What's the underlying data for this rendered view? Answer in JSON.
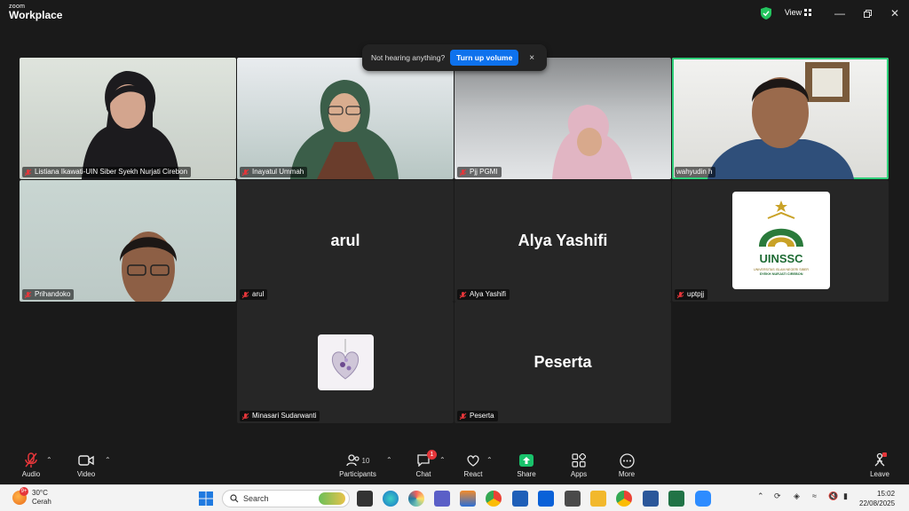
{
  "app": {
    "logo_small": "zoom",
    "logo_big": "Workplace",
    "view_label": "View"
  },
  "notification": {
    "text": "Not hearing anything?",
    "button": "Turn up volume",
    "close": "×"
  },
  "participants": [
    {
      "name": "Listiana Ikawati-UIN Siber Syekh Nurjati Cirebon",
      "video": true
    },
    {
      "name": "Inayatul Ummah",
      "video": true
    },
    {
      "name": "Pjj PGMI",
      "video": true
    },
    {
      "name": "wahyudin h",
      "video": true,
      "active_speaker": true
    },
    {
      "name": "Prihandoko",
      "video": true
    },
    {
      "name": "arul",
      "display": "arul",
      "video": false
    },
    {
      "name": "Alya Yashifi",
      "display": "Alya Yashifi",
      "video": false
    },
    {
      "name": "uptpjj",
      "video": false,
      "logo_text": "UINSSC",
      "logo_sub": "UNIVERSITAS ISLAM NEGERI SIBER\nSYEKH NURJATI CIREBON"
    },
    {
      "name": "Minasari Sudarwanti",
      "video": false
    },
    {
      "name": "Peserta",
      "display": "Peserta",
      "video": false
    }
  ],
  "toolbar": {
    "audio": "Audio",
    "video": "Video",
    "participants": "Participants",
    "participants_count": "10",
    "chat": "Chat",
    "chat_badge": "1",
    "react": "React",
    "share": "Share",
    "apps": "Apps",
    "more": "More",
    "leave": "Leave"
  },
  "taskbar": {
    "weather_temp": "30°C",
    "weather_desc": "Cerah",
    "weather_badge": "9+",
    "search_placeholder": "Search",
    "time": "15:02",
    "date": "22/08/2025"
  },
  "colors": {
    "active_speaker": "#2fd07a",
    "accent": "#0e72ed",
    "share": "#19c26b",
    "badge": "#e5363a"
  }
}
